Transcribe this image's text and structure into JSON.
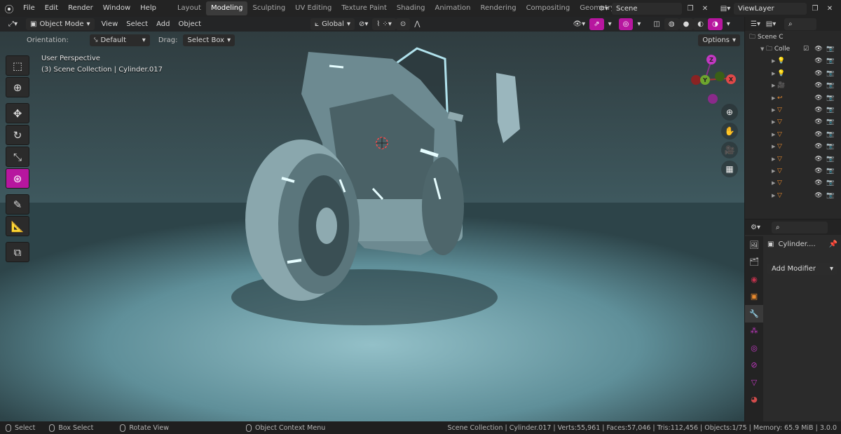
{
  "topbar": {
    "menus": [
      "File",
      "Edit",
      "Render",
      "Window",
      "Help"
    ],
    "workspaces": [
      "Layout",
      "Modeling",
      "Sculpting",
      "UV Editing",
      "Texture Paint",
      "Shading",
      "Animation",
      "Rendering",
      "Compositing",
      "Geometry Nod"
    ],
    "active_workspace": "Modeling",
    "scene_name": "Scene",
    "view_layer": "ViewLayer"
  },
  "viewport_header": {
    "mode": "Object Mode",
    "menus": [
      "View",
      "Select",
      "Add",
      "Object"
    ],
    "transform_orientation": "Global",
    "orientation_label": "Orientation:",
    "orientation_value": "Default",
    "drag_label": "Drag:",
    "drag_value": "Select Box",
    "options_label": "Options"
  },
  "viewport_info": {
    "line1": "User Perspective",
    "line2": "(3) Scene Collection | Cylinder.017"
  },
  "gizmo": {
    "z": "Z",
    "y": "Y",
    "x": "X"
  },
  "outliner": {
    "scene_label": "Scene C",
    "collection_label": "Colle",
    "rows": 13
  },
  "properties": {
    "object_name": "Cylinder....",
    "add_modifier": "Add Modifier"
  },
  "statusbar": {
    "select": "Select",
    "box_select": "Box Select",
    "rotate_view": "Rotate View",
    "context_menu": "Object Context Menu",
    "stats": "Scene Collection | Cylinder.017 | Verts:55,961 | Faces:57,046 | Tris:112,456 | Objects:1/75 | Memory: 65.9 MiB | 3.0.0"
  },
  "colors": {
    "active_tool": "#b7169f",
    "workspace_active_bg": "#3b3b3b",
    "object_icon": "#e98a2e"
  }
}
